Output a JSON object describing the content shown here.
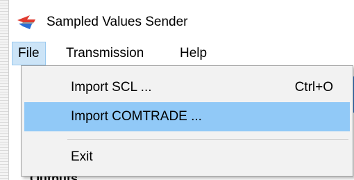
{
  "window": {
    "title": "Sampled Values Sender",
    "app_icon": "app-logo-icon"
  },
  "menubar": {
    "items": [
      {
        "label": "File",
        "active": true
      },
      {
        "label": "Transmission",
        "active": false
      },
      {
        "label": "Help",
        "active": false
      }
    ]
  },
  "file_menu": {
    "items": [
      {
        "label": "Import SCL ...",
        "shortcut": "Ctrl+O",
        "highlighted": false
      },
      {
        "label": "Import COMTRADE ...",
        "shortcut": "",
        "highlighted": true
      },
      {
        "label": "Exit",
        "shortcut": "",
        "highlighted": false
      }
    ]
  },
  "colors": {
    "menu_active_bg": "#cce4f7",
    "menu_item_hover_bg": "#91c9f7",
    "dropdown_bg": "#f2f2f2",
    "background_accent": "#2a74c9"
  }
}
